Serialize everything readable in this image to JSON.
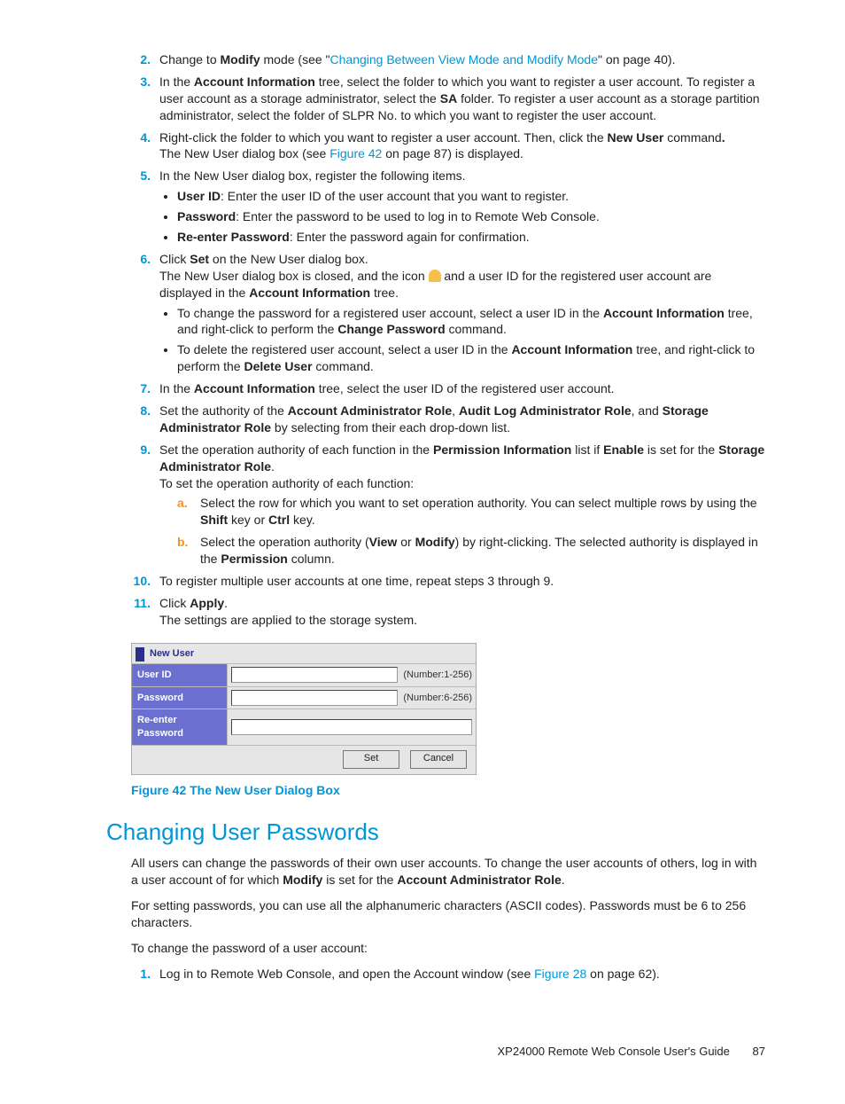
{
  "steps": {
    "s2": {
      "num": "2.",
      "pre": "Change to ",
      "b1": "Modify",
      "mid": " mode (see \"",
      "link": "Changing Between View Mode and Modify Mode",
      "post": "\" on page 40)."
    },
    "s3": {
      "num": "3.",
      "t1": "In the ",
      "b1": "Account Information",
      "t2": " tree, select the folder to which you want to register a user account. To register a user account as a storage administrator, select the ",
      "b2": "SA",
      "t3": " folder. To register a user account as a storage partition administrator, select the folder of SLPR No. to which you want to register the user account."
    },
    "s4": {
      "num": "4.",
      "t1": "Right-click the folder to which you want to register a user account. Then, click the ",
      "b1": "New User",
      "t2": " command",
      "b2": ".",
      "line2a": "The New User dialog box (see ",
      "link": "Figure 42",
      "line2b": " on page 87) is displayed."
    },
    "s5": {
      "num": "5.",
      "t1": "In the New User dialog box, register the following items.",
      "uid_b": "User ID",
      "uid_t": ": Enter the user ID of the user account that you want to register.",
      "pw_b": "Password",
      "pw_t": ": Enter the password to be used to log in to Remote Web Console.",
      "rpw_b": "Re-enter Password",
      "rpw_t": ": Enter the password again for confirmation."
    },
    "s6": {
      "num": "6.",
      "t1": "Click ",
      "b1": "Set",
      "t2": " on the New User dialog box.",
      "l2a": "The New User dialog box is closed, and the icon ",
      "l2b": " and a user ID for the registered user account are displayed in the ",
      "b2": "Account Information",
      "l2c": " tree.",
      "bul1a": "To change the password for a registered user account, select a user ID in the ",
      "bul1b1": "Account Information",
      "bul1c": " tree, and right-click to perform the ",
      "bul1b2": "Change Password",
      "bul1d": " command.",
      "bul2a": "To delete the registered user account, select a user ID in the ",
      "bul2b1": "Account Information",
      "bul2c": " tree, and right-click to perform the ",
      "bul2b2": "Delete User",
      "bul2d": " command."
    },
    "s7": {
      "num": "7.",
      "t1": "In the ",
      "b1": "Account Information",
      "t2": " tree, select the user ID of the registered user account."
    },
    "s8": {
      "num": "8.",
      "t1": "Set the authority of the ",
      "b1": "Account Administrator Role",
      "t2": ", ",
      "b2": "Audit Log Administrator Role",
      "t3": ", and ",
      "b3": "Storage Administrator Role",
      "t4": " by selecting from their each drop-down list."
    },
    "s9": {
      "num": "9.",
      "t1": "Set the operation authority of each function in the ",
      "b1": "Permission Information",
      "t2": " list if ",
      "b2": "Enable",
      "t3": " is set for the ",
      "b3": "Storage Administrator Role",
      "t4": ".",
      "l2": "To set the operation authority of each function:",
      "a_letter": "a.",
      "a_t1": "Select the row for which you want to set operation authority. You can select multiple rows by using the ",
      "a_b1": "Shift",
      "a_t2": " key or ",
      "a_b2": "Ctrl",
      "a_t3": " key.",
      "b_letter": "b.",
      "b_t1": "Select the operation authority (",
      "b_b1": "View",
      "b_t2": " or ",
      "b_b2": "Modify",
      "b_t3": ") by right-clicking. The selected authority is displayed in the ",
      "b_b3": "Permission",
      "b_t4": " column."
    },
    "s10": {
      "num": "10.",
      "t": "To register multiple user accounts at one time, repeat steps 3 through 9."
    },
    "s11": {
      "num": "11.",
      "t1": "Click ",
      "b1": "Apply",
      "t2": ".",
      "l2": "The settings are applied to the storage system."
    }
  },
  "dialog": {
    "title": "New User",
    "rows": {
      "uid": {
        "label": "User ID",
        "hint": "(Number:1-256)"
      },
      "pw": {
        "label": "Password",
        "hint": "(Number:6-256)"
      },
      "rpw": {
        "label": "Re-enter Password"
      }
    },
    "set": "Set",
    "cancel": "Cancel"
  },
  "figure_caption": "Figure 42 The New User Dialog Box",
  "section_heading": "Changing User Passwords",
  "para1": {
    "t1": "All users can change the passwords of their own user accounts. To change the user accounts of others, log in with a user account of for which ",
    "b1": "Modify",
    "t2": " is set for the ",
    "b2": "Account Administrator Role",
    "t3": "."
  },
  "para2": "For setting passwords, you can use all the alphanumeric characters (ASCII codes). Passwords must be 6 to 256 characters.",
  "para3": "To change the password of a user account:",
  "second_list": {
    "s1": {
      "num": "1.",
      "t1": "Log in to Remote Web Console, and open the Account window (see ",
      "link": "Figure 28",
      "t2": " on page 62)."
    }
  },
  "footer": {
    "guide": "XP24000 Remote Web Console User's Guide",
    "page": "87"
  }
}
